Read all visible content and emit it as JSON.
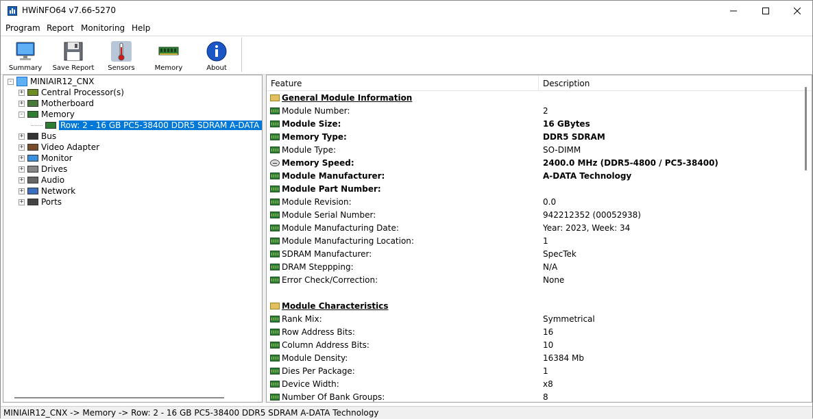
{
  "window": {
    "title": "HWiNFO64 v7.66-5270"
  },
  "menu": [
    "Program",
    "Report",
    "Monitoring",
    "Help"
  ],
  "toolbar": [
    {
      "label": "Summary",
      "icon": "monitor-icon"
    },
    {
      "label": "Save Report",
      "icon": "floppy-icon"
    },
    {
      "label": "Sensors",
      "icon": "thermometer-icon"
    },
    {
      "label": "Memory",
      "icon": "memory-module-icon"
    },
    {
      "label": "About",
      "icon": "info-icon"
    }
  ],
  "tree": {
    "root": "MINIAIR12_CNX",
    "nodes": [
      {
        "label": "Central Processor(s)",
        "expander": "+",
        "icon": "cpu-icon"
      },
      {
        "label": "Motherboard",
        "expander": "+",
        "icon": "motherboard-icon"
      },
      {
        "label": "Memory",
        "expander": "-",
        "icon": "memory-icon"
      },
      {
        "label": "Row: 2 - 16 GB PC5-38400 DDR5 SDRAM A-DATA Technology",
        "expander": "",
        "icon": "memory-module-icon",
        "selected": true
      },
      {
        "label": "Bus",
        "expander": "+",
        "icon": "bus-icon"
      },
      {
        "label": "Video Adapter",
        "expander": "+",
        "icon": "video-card-icon"
      },
      {
        "label": "Monitor",
        "expander": "+",
        "icon": "display-icon"
      },
      {
        "label": "Drives",
        "expander": "+",
        "icon": "drive-icon"
      },
      {
        "label": "Audio",
        "expander": "+",
        "icon": "speaker-icon"
      },
      {
        "label": "Network",
        "expander": "+",
        "icon": "network-icon"
      },
      {
        "label": "Ports",
        "expander": "+",
        "icon": "port-icon"
      }
    ]
  },
  "list": {
    "columns": [
      "Feature",
      "Description"
    ],
    "rows": [
      {
        "feature": "General Module Information",
        "value": "",
        "type": "section"
      },
      {
        "feature": "Module Number:",
        "value": "2",
        "type": "normal"
      },
      {
        "feature": "Module Size:",
        "value": "16 GBytes",
        "type": "bold"
      },
      {
        "feature": "Memory Type:",
        "value": "DDR5 SDRAM",
        "type": "bold"
      },
      {
        "feature": "Module Type:",
        "value": "SO-DIMM",
        "type": "normal"
      },
      {
        "feature": "Memory Speed:",
        "value": "2400.0 MHz (DDR5-4800 / PC5-38400)",
        "type": "bold",
        "icon": "clock"
      },
      {
        "feature": "Module Manufacturer:",
        "value": "A-DATA Technology",
        "type": "bold"
      },
      {
        "feature": "Module Part Number:",
        "value": "",
        "type": "bold"
      },
      {
        "feature": "Module Revision:",
        "value": "0.0",
        "type": "normal"
      },
      {
        "feature": "Module Serial Number:",
        "value": "942212352 (00052938)",
        "type": "normal"
      },
      {
        "feature": "Module Manufacturing Date:",
        "value": "Year: 2023, Week: 34",
        "type": "normal"
      },
      {
        "feature": "Module Manufacturing Location:",
        "value": "1",
        "type": "normal"
      },
      {
        "feature": "SDRAM Manufacturer:",
        "value": "SpecTek",
        "type": "normal"
      },
      {
        "feature": "DRAM Steppping:",
        "value": "N/A",
        "type": "normal"
      },
      {
        "feature": "Error Check/Correction:",
        "value": "None",
        "type": "normal"
      },
      {
        "feature": "",
        "value": "",
        "type": "blank"
      },
      {
        "feature": "Module Characteristics",
        "value": "",
        "type": "section"
      },
      {
        "feature": "Rank Mix:",
        "value": "Symmetrical",
        "type": "normal"
      },
      {
        "feature": "Row Address Bits:",
        "value": "16",
        "type": "normal"
      },
      {
        "feature": "Column Address Bits:",
        "value": "10",
        "type": "normal"
      },
      {
        "feature": "Module Density:",
        "value": "16384 Mb",
        "type": "normal"
      },
      {
        "feature": "Dies Per Package:",
        "value": "1",
        "type": "normal"
      },
      {
        "feature": "Device Width:",
        "value": "x8",
        "type": "normal"
      },
      {
        "feature": "Number Of Bank Groups:",
        "value": "8",
        "type": "normal"
      }
    ]
  },
  "status": {
    "path": "MINIAIR12_CNX -> Memory -> Row: 2 - 16 GB PC5-38400 DDR5 SDRAM A-DATA Technology"
  }
}
